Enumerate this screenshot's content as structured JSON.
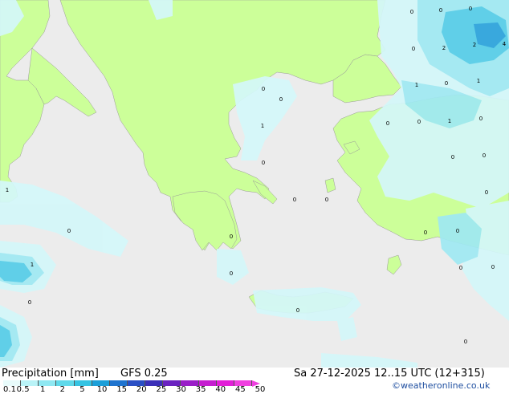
{
  "footer": {
    "title": "Precipitation [mm]",
    "model": "GFS 0.25",
    "datetime": "Sa 27-12-2025 12..15 UTC (12+315)",
    "copyright": "©weatheronline.co.uk"
  },
  "legend": {
    "labels": [
      "0.1",
      "0.5",
      "1",
      "2",
      "5",
      "10",
      "15",
      "20",
      "25",
      "30",
      "35",
      "40",
      "45",
      "50"
    ],
    "colors": [
      "#e8fbfb",
      "#b9f3f7",
      "#8fe8f2",
      "#5fd9ea",
      "#35c3e2",
      "#1c9fd8",
      "#1f74cf",
      "#2a4fc4",
      "#3b30b8",
      "#6a22c0",
      "#9a1ec8",
      "#c51ed0",
      "#e21fd8",
      "#f040e0"
    ]
  },
  "colors": {
    "sea": "#ececec",
    "land": "#ccff99",
    "precip_light": "#d4f7fa",
    "precip_medium": "#9fe9f3",
    "precip_heavy": "#55cde8",
    "precip_strong": "#2aa3dc"
  },
  "map_labels": [
    {
      "text": "0"
    },
    {
      "text": "0"
    },
    {
      "text": "0"
    },
    {
      "text": "2"
    },
    {
      "text": "2"
    },
    {
      "text": "4"
    },
    {
      "text": "0"
    },
    {
      "text": "1"
    },
    {
      "text": "0"
    },
    {
      "text": "1"
    },
    {
      "text": "0"
    },
    {
      "text": "1"
    },
    {
      "text": "0"
    },
    {
      "text": "0"
    },
    {
      "text": "0"
    },
    {
      "text": "1"
    },
    {
      "text": "0"
    },
    {
      "text": "0"
    },
    {
      "text": "0"
    },
    {
      "text": "0"
    },
    {
      "text": "0"
    },
    {
      "text": "0"
    },
    {
      "text": "1"
    },
    {
      "text": "1"
    },
    {
      "text": "0"
    },
    {
      "text": "0"
    },
    {
      "text": "0"
    },
    {
      "text": "0"
    },
    {
      "text": "0"
    },
    {
      "text": "0"
    },
    {
      "text": "0"
    },
    {
      "text": "0"
    },
    {
      "text": "0"
    },
    {
      "text": "0"
    },
    {
      "text": "0"
    }
  ]
}
